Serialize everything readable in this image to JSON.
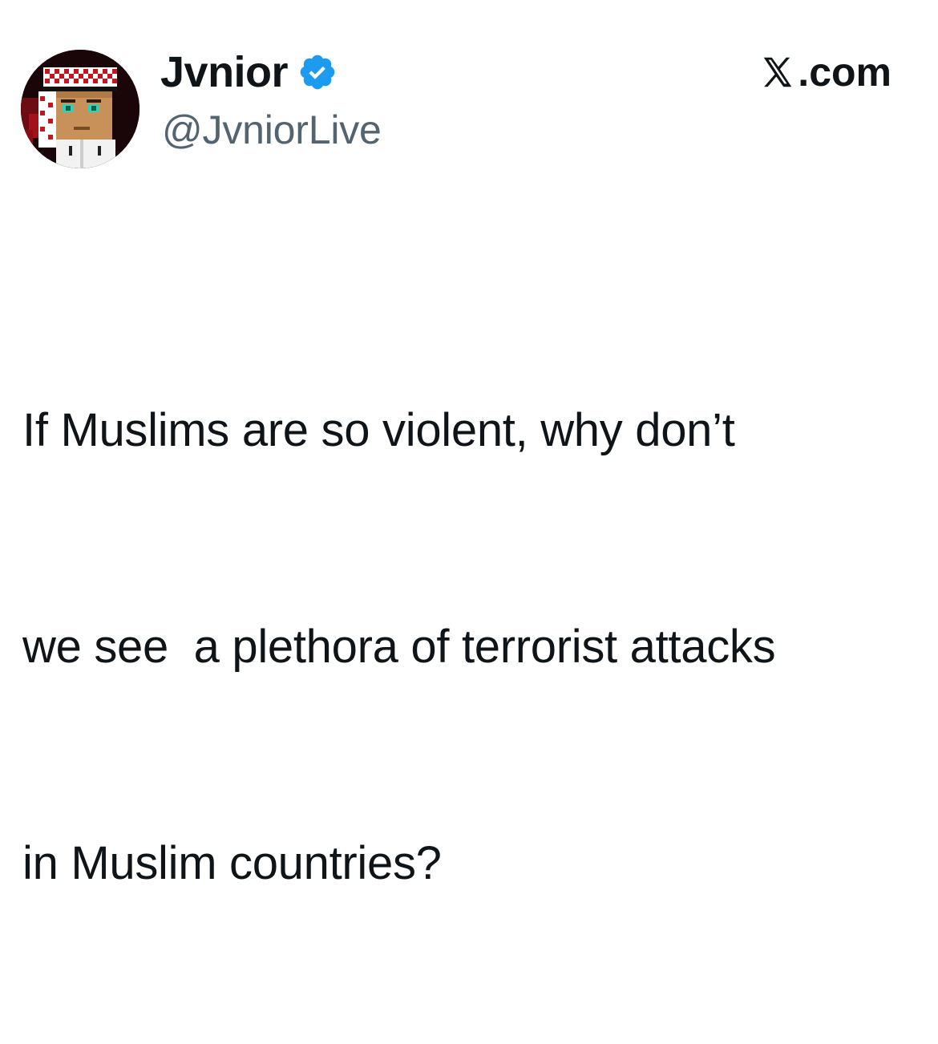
{
  "author": {
    "display_name": "Jvnior",
    "handle": "@JvniorLive",
    "verified": true,
    "avatar_icon": "pixel-art-avatar-icon",
    "verified_icon": "verified-badge-icon"
  },
  "brand": {
    "label": ".com",
    "icon": "x-logo-icon"
  },
  "tweet": {
    "lines": [
      "If Muslims are so violent, why don’t",
      "we see  a plethora of terrorist attacks",
      "in Muslim countries?"
    ]
  },
  "colors": {
    "text_primary": "#0f1419",
    "text_secondary": "#536471",
    "verified_blue": "#1d9bf0",
    "background": "#ffffff"
  }
}
